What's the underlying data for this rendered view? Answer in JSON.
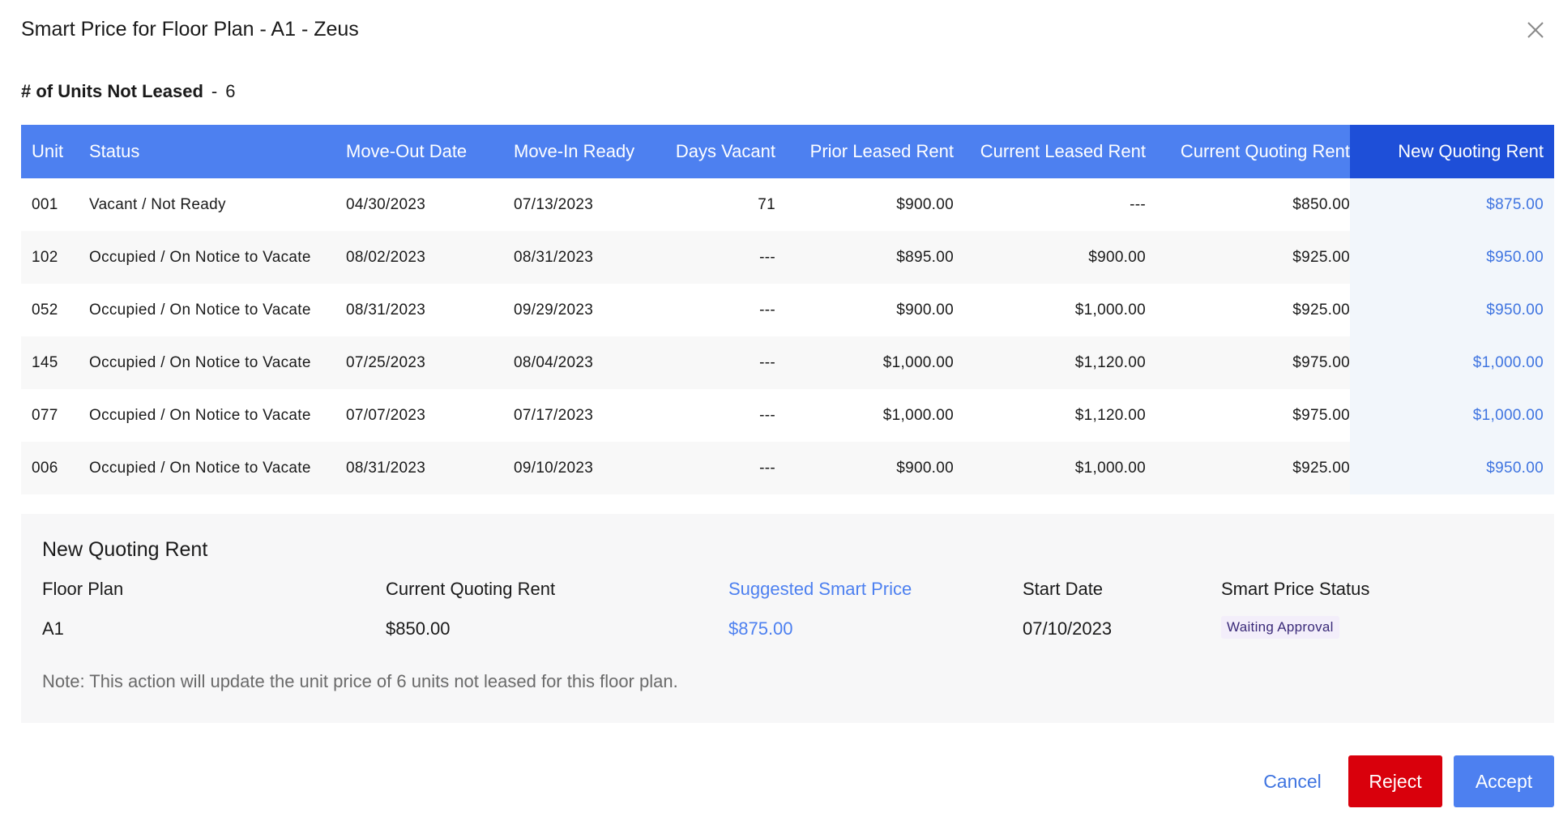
{
  "modal": {
    "title": "Smart Price for Floor Plan - A1 - Zeus",
    "close_icon": "close-icon"
  },
  "units_summary": {
    "label": "# of Units Not Leased",
    "separator": "-",
    "count": "6"
  },
  "table": {
    "headers": {
      "unit": "Unit",
      "status": "Status",
      "move_out": "Move-Out Date",
      "move_in": "Move-In Ready",
      "days_vacant": "Days Vacant",
      "prior_leased_rent": "Prior Leased Rent",
      "current_leased_rent": "Current Leased Rent",
      "current_quoting_rent": "Current Quoting Rent",
      "new_quoting_rent": "New Quoting Rent"
    },
    "rows": [
      {
        "unit": "001",
        "status": "Vacant / Not Ready",
        "move_out": "04/30/2023",
        "move_in": "07/13/2023",
        "days_vacant": "71",
        "prior": "$900.00",
        "cur_leased": "---",
        "cur_quote": "$850.00",
        "new_quote": "$875.00"
      },
      {
        "unit": "102",
        "status": "Occupied / On Notice to Vacate",
        "move_out": "08/02/2023",
        "move_in": "08/31/2023",
        "days_vacant": "---",
        "prior": "$895.00",
        "cur_leased": "$900.00",
        "cur_quote": "$925.00",
        "new_quote": "$950.00"
      },
      {
        "unit": "052",
        "status": "Occupied / On Notice to Vacate",
        "move_out": "08/31/2023",
        "move_in": "09/29/2023",
        "days_vacant": "---",
        "prior": "$900.00",
        "cur_leased": "$1,000.00",
        "cur_quote": "$925.00",
        "new_quote": "$950.00"
      },
      {
        "unit": "145",
        "status": "Occupied / On Notice to Vacate",
        "move_out": "07/25/2023",
        "move_in": "08/04/2023",
        "days_vacant": "---",
        "prior": "$1,000.00",
        "cur_leased": "$1,120.00",
        "cur_quote": "$975.00",
        "new_quote": "$1,000.00"
      },
      {
        "unit": "077",
        "status": "Occupied / On Notice to Vacate",
        "move_out": "07/07/2023",
        "move_in": "07/17/2023",
        "days_vacant": "---",
        "prior": "$1,000.00",
        "cur_leased": "$1,120.00",
        "cur_quote": "$975.00",
        "new_quote": "$1,000.00"
      },
      {
        "unit": "006",
        "status": "Occupied / On Notice to Vacate",
        "move_out": "08/31/2023",
        "move_in": "09/10/2023",
        "days_vacant": "---",
        "prior": "$900.00",
        "cur_leased": "$1,000.00",
        "cur_quote": "$925.00",
        "new_quote": "$950.00"
      }
    ]
  },
  "panel": {
    "title": "New Quoting Rent",
    "floor_plan_label": "Floor Plan",
    "floor_plan_value": "A1",
    "current_quoting_label": "Current Quoting Rent",
    "current_quoting_value": "$850.00",
    "suggested_label": "Suggested Smart Price",
    "suggested_value": "$875.00",
    "start_date_label": "Start Date",
    "start_date_value": "07/10/2023",
    "status_label": "Smart Price Status",
    "status_value": "Waiting Approval",
    "note": "Note: This action will update the unit price of 6 units not leased for this floor plan."
  },
  "buttons": {
    "cancel": "Cancel",
    "reject": "Reject",
    "accept": "Accept"
  },
  "colors": {
    "header_blue": "#4d80f0",
    "header_dark_blue": "#1e4fd8",
    "link_blue": "#3f74e0",
    "reject_red": "#d9000c"
  }
}
